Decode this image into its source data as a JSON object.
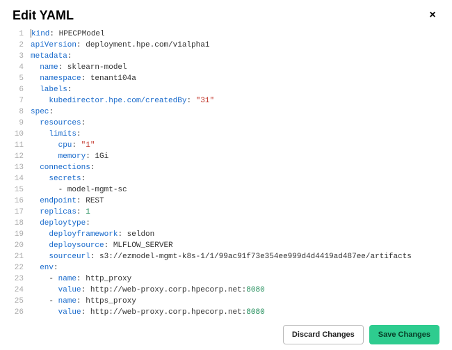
{
  "dialog": {
    "title": "Edit YAML",
    "close_symbol": "×"
  },
  "buttons": {
    "discard": "Discard Changes",
    "save": "Save Changes"
  },
  "code": {
    "lines": [
      [
        [
          "key",
          "kind"
        ],
        [
          "plain",
          ": HPECPModel"
        ]
      ],
      [
        [
          "key",
          "apiVersion"
        ],
        [
          "plain",
          ": deployment.hpe.com/v1alpha1"
        ]
      ],
      [
        [
          "key",
          "metadata"
        ],
        [
          "plain",
          ":"
        ]
      ],
      [
        [
          "plain",
          "  "
        ],
        [
          "key",
          "name"
        ],
        [
          "plain",
          ": sklearn-model"
        ]
      ],
      [
        [
          "plain",
          "  "
        ],
        [
          "key",
          "namespace"
        ],
        [
          "plain",
          ": tenant104a"
        ]
      ],
      [
        [
          "plain",
          "  "
        ],
        [
          "key",
          "labels"
        ],
        [
          "plain",
          ":"
        ]
      ],
      [
        [
          "plain",
          "    "
        ],
        [
          "key",
          "kubedirector.hpe.com/createdBy"
        ],
        [
          "plain",
          ": "
        ],
        [
          "str",
          "\"31\""
        ]
      ],
      [
        [
          "key",
          "spec"
        ],
        [
          "plain",
          ":"
        ]
      ],
      [
        [
          "plain",
          "  "
        ],
        [
          "key",
          "resources"
        ],
        [
          "plain",
          ":"
        ]
      ],
      [
        [
          "plain",
          "    "
        ],
        [
          "key",
          "limits"
        ],
        [
          "plain",
          ":"
        ]
      ],
      [
        [
          "plain",
          "      "
        ],
        [
          "key",
          "cpu"
        ],
        [
          "plain",
          ": "
        ],
        [
          "str",
          "\"1\""
        ]
      ],
      [
        [
          "plain",
          "      "
        ],
        [
          "key",
          "memory"
        ],
        [
          "plain",
          ": 1Gi"
        ]
      ],
      [
        [
          "plain",
          "  "
        ],
        [
          "key",
          "connections"
        ],
        [
          "plain",
          ":"
        ]
      ],
      [
        [
          "plain",
          "    "
        ],
        [
          "key",
          "secrets"
        ],
        [
          "plain",
          ":"
        ]
      ],
      [
        [
          "plain",
          "      - model-mgmt-sc"
        ]
      ],
      [
        [
          "plain",
          "  "
        ],
        [
          "key",
          "endpoint"
        ],
        [
          "plain",
          ": REST"
        ]
      ],
      [
        [
          "plain",
          "  "
        ],
        [
          "key",
          "replicas"
        ],
        [
          "plain",
          ": "
        ],
        [
          "num",
          "1"
        ]
      ],
      [
        [
          "plain",
          "  "
        ],
        [
          "key",
          "deploytype"
        ],
        [
          "plain",
          ":"
        ]
      ],
      [
        [
          "plain",
          "    "
        ],
        [
          "key",
          "deployframework"
        ],
        [
          "plain",
          ": seldon"
        ]
      ],
      [
        [
          "plain",
          "    "
        ],
        [
          "key",
          "deploysource"
        ],
        [
          "plain",
          ": MLFLOW_SERVER"
        ]
      ],
      [
        [
          "plain",
          "    "
        ],
        [
          "key",
          "sourceurl"
        ],
        [
          "plain",
          ": s3://ezmodel-mgmt-k8s-1/1/99ac91f73e354ee999d4d4419ad487ee/artifacts"
        ]
      ],
      [
        [
          "plain",
          "  "
        ],
        [
          "key",
          "env"
        ],
        [
          "plain",
          ":"
        ]
      ],
      [
        [
          "plain",
          "    - "
        ],
        [
          "key",
          "name"
        ],
        [
          "plain",
          ": http_proxy"
        ]
      ],
      [
        [
          "plain",
          "      "
        ],
        [
          "key",
          "value"
        ],
        [
          "plain",
          ": http://web-proxy.corp.hpecorp.net:"
        ],
        [
          "num",
          "8080"
        ]
      ],
      [
        [
          "plain",
          "    - "
        ],
        [
          "key",
          "name"
        ],
        [
          "plain",
          ": https_proxy"
        ]
      ],
      [
        [
          "plain",
          "      "
        ],
        [
          "key",
          "value"
        ],
        [
          "plain",
          ": http://web-proxy.corp.hpecorp.net:"
        ],
        [
          "num",
          "8080"
        ]
      ],
      [
        [
          "plain",
          ""
        ]
      ]
    ]
  }
}
